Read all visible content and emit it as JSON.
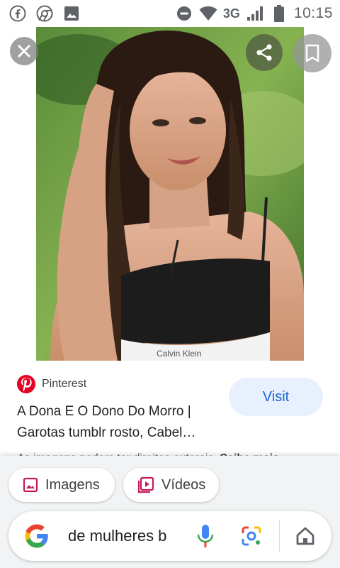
{
  "status_bar": {
    "network": "3G",
    "time": "10:15",
    "icons": [
      "facebook-icon",
      "chrome-icon",
      "gallery-icon",
      "do-not-disturb-icon",
      "wifi-icon",
      "signal-icon",
      "battery-icon"
    ]
  },
  "viewer": {
    "buttons": [
      "close-icon",
      "share-icon",
      "bookmark-icon"
    ],
    "image_brand_text": "Calvin Klein"
  },
  "result": {
    "source": "Pinterest",
    "title_line1": "A Dona E O Dono Do Morro |",
    "title_line2": "Garotas tumblr rosto, Cabel…",
    "visit_label": "Visit",
    "rights_text": "As imagens podem ter direitos autorais.",
    "rights_link": "Saiba mais"
  },
  "bottom": {
    "chips": [
      {
        "label": "Imagens",
        "icon": "image-icon"
      },
      {
        "label": "Vídeos",
        "icon": "video-icon"
      }
    ],
    "search_query": "de mulheres b",
    "search_icons": [
      "google-logo-icon",
      "mic-icon",
      "lens-icon",
      "home-icon"
    ]
  },
  "colors": {
    "visit_bg": "#e8f0fe",
    "visit_text": "#1967d2",
    "pinterest_red": "#e60023",
    "chip_icon": "#c5185d"
  }
}
